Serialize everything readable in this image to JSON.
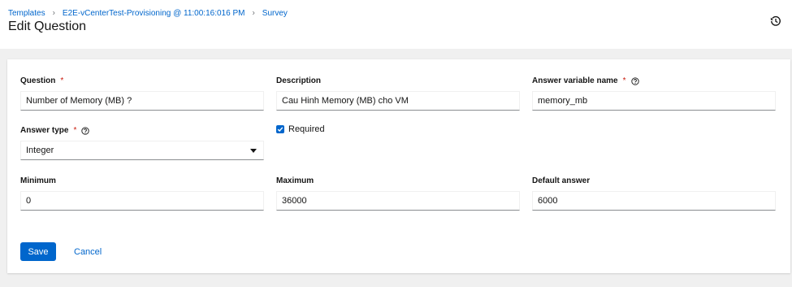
{
  "breadcrumb": {
    "items": [
      "Templates",
      "E2E-vCenterTest-Provisioning @ 11:00:16:016 PM",
      "Survey"
    ]
  },
  "header": {
    "title": "Edit Question"
  },
  "form": {
    "question": {
      "label": "Question",
      "required_mark": "*",
      "value": "Number of Memory (MB) ?"
    },
    "description": {
      "label": "Description",
      "value": "Cau Hinh Memory (MB) cho VM"
    },
    "variable": {
      "label": "Answer variable name",
      "required_mark": "*",
      "value": "memory_mb"
    },
    "answer_type": {
      "label": "Answer type",
      "required_mark": "*",
      "value": "Integer"
    },
    "required": {
      "label": "Required",
      "checked": true
    },
    "minimum": {
      "label": "Minimum",
      "value": "0"
    },
    "maximum": {
      "label": "Maximum",
      "value": "36000"
    },
    "default": {
      "label": "Default answer",
      "value": "6000"
    }
  },
  "actions": {
    "save_label": "Save",
    "cancel_label": "Cancel"
  },
  "colors": {
    "accent": "#0066cc",
    "required": "#c9190b",
    "page_bg": "#f0f0f0"
  }
}
